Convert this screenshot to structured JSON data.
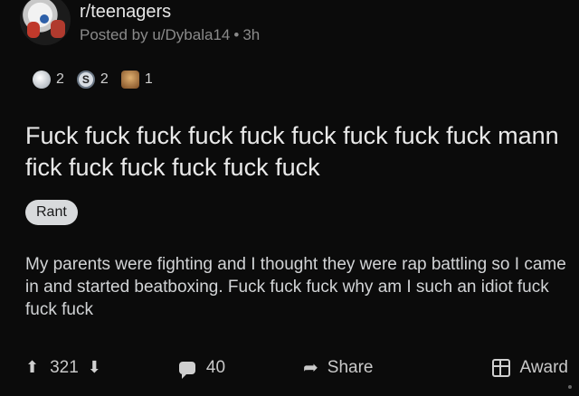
{
  "post": {
    "subreddit": "r/teenagers",
    "posted_by_prefix": "Posted by",
    "author": "u/Dybala14",
    "separator": "•",
    "age": "3h",
    "awards": [
      {
        "icon": "silver-award-icon",
        "count": "2"
      },
      {
        "icon": "helpful-award-icon",
        "count": "2"
      },
      {
        "icon": "wholesome-award-icon",
        "count": "1"
      }
    ],
    "title": "Fuck fuck fuck fuck fuck fuck fuck fuck fuck mann fick fuck fuck fuck fuck fuck",
    "flair": "Rant",
    "body": "My parents were fighting and I thought they were rap battling so I  came in and started beatboxing. Fuck fuck fuck why am I such an idiot fuck fuck fuck"
  },
  "footer": {
    "score": "321",
    "comments": "40",
    "share_label": "Share",
    "award_label": "Award"
  }
}
